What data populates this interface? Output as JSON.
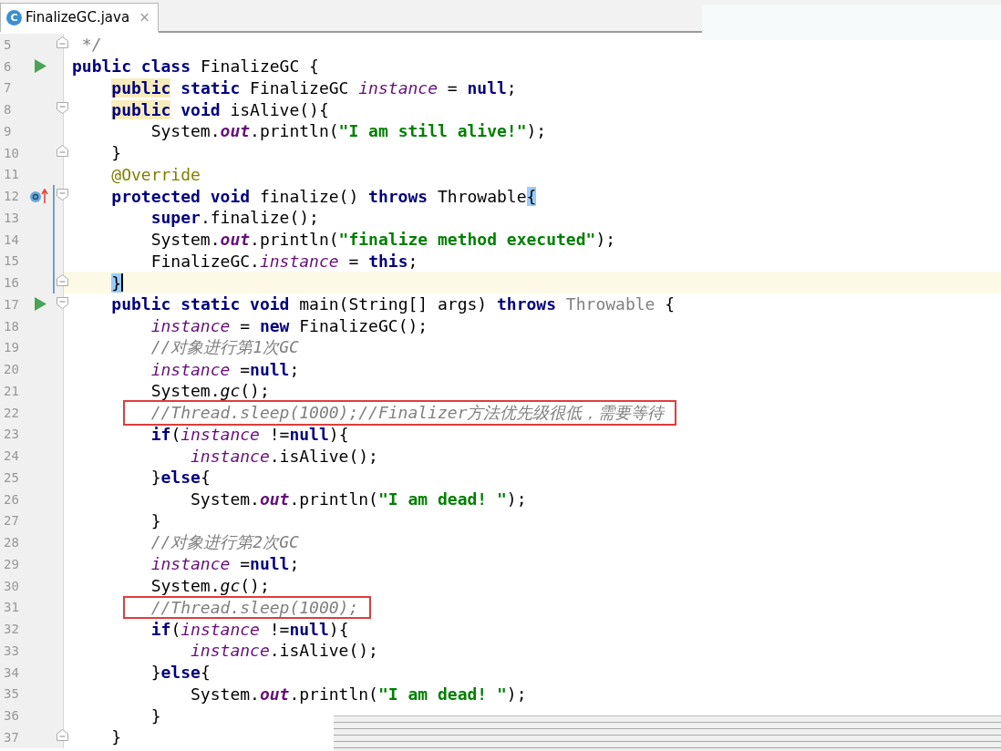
{
  "tab": {
    "label": "FinalizeGC.java",
    "selected": true,
    "icon": "C",
    "close": "×"
  },
  "lines": [
    {
      "number": "5",
      "fold_end": true,
      "tokens": [
        {
          "kind": "comment",
          "text": " */"
        }
      ]
    },
    {
      "number": "6",
      "run_marker": true,
      "tokens": [
        {
          "kind": "keyword",
          "text": "public class"
        },
        {
          "kind": "plain",
          "text": " FinalizeGC {"
        }
      ],
      "children": [
        {
          "number": "7",
          "tokens": [
            {
              "kind": "keyword",
              "text": "public",
              "usage_highlight": true
            },
            {
              "kind": "keyword",
              "text": " static"
            },
            {
              "kind": "plain",
              "text": " FinalizeGC "
            },
            {
              "kind": "field",
              "text": "instance"
            },
            {
              "kind": "plain",
              "text": " = "
            },
            {
              "kind": "keyword",
              "text": "null"
            },
            {
              "kind": "plain",
              "text": ";"
            }
          ]
        },
        {
          "number": "8",
          "fold_start": true,
          "tokens": [
            {
              "kind": "keyword",
              "text": "public",
              "usage_highlight": true
            },
            {
              "kind": "keyword",
              "text": " void"
            },
            {
              "kind": "plain",
              "text": " isAlive(){"
            }
          ],
          "children": [
            {
              "number": "9",
              "tokens": [
                {
                  "kind": "plain",
                  "text": "System."
                },
                {
                  "kind": "static-field",
                  "text": "out"
                },
                {
                  "kind": "plain",
                  "text": ".println("
                },
                {
                  "kind": "string",
                  "text": "\"I am still alive!\""
                },
                {
                  "kind": "plain",
                  "text": ");"
                }
              ]
            }
          ]
        },
        {
          "number": "10",
          "fold_end": true,
          "tokens": [
            {
              "kind": "plain",
              "text": "}"
            }
          ]
        },
        {
          "number": "11",
          "tokens": [
            {
              "kind": "annotation",
              "text": "@Override"
            }
          ]
        },
        {
          "number": "12",
          "override_marker": true,
          "fold_start": true,
          "changed": true,
          "tokens": [
            {
              "kind": "keyword",
              "text": "protected void"
            },
            {
              "kind": "plain",
              "text": " finalize() "
            },
            {
              "kind": "keyword",
              "text": "throws"
            },
            {
              "kind": "plain",
              "text": " Throwable"
            },
            {
              "kind": "plain",
              "text": "{",
              "brace_match": true
            }
          ],
          "children": [
            {
              "number": "13",
              "changed": true,
              "tokens": [
                {
                  "kind": "keyword",
                  "text": "super"
                },
                {
                  "kind": "plain",
                  "text": ".finalize();"
                }
              ]
            },
            {
              "number": "14",
              "changed": true,
              "tokens": [
                {
                  "kind": "plain",
                  "text": "System."
                },
                {
                  "kind": "static-field",
                  "text": "out"
                },
                {
                  "kind": "plain",
                  "text": ".println("
                },
                {
                  "kind": "string",
                  "text": "\"finalize method executed\""
                },
                {
                  "kind": "plain",
                  "text": ");"
                }
              ]
            },
            {
              "number": "15",
              "changed": true,
              "tokens": [
                {
                  "kind": "plain",
                  "text": "FinalizeGC."
                },
                {
                  "kind": "field",
                  "text": "instance"
                },
                {
                  "kind": "plain",
                  "text": " = "
                },
                {
                  "kind": "keyword",
                  "text": "this"
                },
                {
                  "kind": "plain",
                  "text": ";"
                }
              ]
            }
          ]
        },
        {
          "number": "16",
          "fold_end": true,
          "changed": true,
          "current": true,
          "caret": true,
          "tokens": [
            {
              "kind": "plain",
              "text": "}",
              "brace_match": true
            }
          ]
        },
        {
          "number": "17",
          "run_marker": true,
          "fold_start": true,
          "tokens": [
            {
              "kind": "keyword",
              "text": "public static void"
            },
            {
              "kind": "plain",
              "text": " main(String[] args) "
            },
            {
              "kind": "keyword",
              "text": "throws"
            },
            {
              "kind": "muted",
              "text": " Throwable"
            },
            {
              "kind": "plain",
              "text": " {"
            }
          ],
          "children": [
            {
              "number": "18",
              "tokens": [
                {
                  "kind": "field",
                  "text": "instance"
                },
                {
                  "kind": "plain",
                  "text": " = "
                },
                {
                  "kind": "keyword",
                  "text": "new"
                },
                {
                  "kind": "plain",
                  "text": " FinalizeGC();"
                }
              ]
            },
            {
              "number": "19",
              "tokens": [
                {
                  "kind": "comment",
                  "text": "//对象进行第1次GC"
                }
              ]
            },
            {
              "number": "20",
              "tokens": [
                {
                  "kind": "field",
                  "text": "instance"
                },
                {
                  "kind": "plain",
                  "text": " ="
                },
                {
                  "kind": "keyword",
                  "text": "null"
                },
                {
                  "kind": "plain",
                  "text": ";"
                }
              ]
            },
            {
              "number": "21",
              "tokens": [
                {
                  "kind": "plain",
                  "text": "System."
                },
                {
                  "kind": "static-call",
                  "text": "gc"
                },
                {
                  "kind": "plain",
                  "text": "();"
                }
              ]
            },
            {
              "number": "22",
              "tokens": [
                {
                  "kind": "comment",
                  "text": "//Thread.sleep(1000);//Finalizer方法优先级很低，需要等待",
                  "boxed": true
                }
              ]
            },
            {
              "number": "23",
              "tokens": [
                {
                  "kind": "keyword",
                  "text": "if"
                },
                {
                  "kind": "plain",
                  "text": "("
                },
                {
                  "kind": "field",
                  "text": "instance"
                },
                {
                  "kind": "plain",
                  "text": " !="
                },
                {
                  "kind": "keyword",
                  "text": "null"
                },
                {
                  "kind": "plain",
                  "text": "){"
                }
              ],
              "children": [
                {
                  "number": "24",
                  "tokens": [
                    {
                      "kind": "field",
                      "text": "instance"
                    },
                    {
                      "kind": "plain",
                      "text": ".isAlive();"
                    }
                  ]
                }
              ]
            },
            {
              "number": "25",
              "tokens": [
                {
                  "kind": "plain",
                  "text": "}"
                },
                {
                  "kind": "keyword",
                  "text": "else"
                },
                {
                  "kind": "plain",
                  "text": "{"
                }
              ],
              "children": [
                {
                  "number": "26",
                  "tokens": [
                    {
                      "kind": "plain",
                      "text": "System."
                    },
                    {
                      "kind": "static-field",
                      "text": "out"
                    },
                    {
                      "kind": "plain",
                      "text": ".println("
                    },
                    {
                      "kind": "string",
                      "text": "\"I am dead! \""
                    },
                    {
                      "kind": "plain",
                      "text": ");"
                    }
                  ]
                }
              ]
            },
            {
              "number": "27",
              "tokens": [
                {
                  "kind": "plain",
                  "text": "}"
                }
              ]
            },
            {
              "number": "28",
              "tokens": [
                {
                  "kind": "comment",
                  "text": "//对象进行第2次GC"
                }
              ]
            },
            {
              "number": "29",
              "tokens": [
                {
                  "kind": "field",
                  "text": "instance"
                },
                {
                  "kind": "plain",
                  "text": " ="
                },
                {
                  "kind": "keyword",
                  "text": "null"
                },
                {
                  "kind": "plain",
                  "text": ";"
                }
              ]
            },
            {
              "number": "30",
              "tokens": [
                {
                  "kind": "plain",
                  "text": "System."
                },
                {
                  "kind": "static-call",
                  "text": "gc"
                },
                {
                  "kind": "plain",
                  "text": "();"
                }
              ]
            },
            {
              "number": "31",
              "tokens": [
                {
                  "kind": "comment",
                  "text": "//Thread.sleep(1000);",
                  "boxed": true
                }
              ]
            },
            {
              "number": "32",
              "tokens": [
                {
                  "kind": "keyword",
                  "text": "if"
                },
                {
                  "kind": "plain",
                  "text": "("
                },
                {
                  "kind": "field",
                  "text": "instance"
                },
                {
                  "kind": "plain",
                  "text": " !="
                },
                {
                  "kind": "keyword",
                  "text": "null"
                },
                {
                  "kind": "plain",
                  "text": "){"
                }
              ],
              "children": [
                {
                  "number": "33",
                  "tokens": [
                    {
                      "kind": "field",
                      "text": "instance"
                    },
                    {
                      "kind": "plain",
                      "text": ".isAlive();"
                    }
                  ]
                }
              ]
            },
            {
              "number": "34",
              "tokens": [
                {
                  "kind": "plain",
                  "text": "}"
                },
                {
                  "kind": "keyword",
                  "text": "else"
                },
                {
                  "kind": "plain",
                  "text": "{"
                }
              ],
              "children": [
                {
                  "number": "35",
                  "tokens": [
                    {
                      "kind": "plain",
                      "text": "System."
                    },
                    {
                      "kind": "static-field",
                      "text": "out"
                    },
                    {
                      "kind": "plain",
                      "text": ".println("
                    },
                    {
                      "kind": "string",
                      "text": "\"I am dead! \""
                    },
                    {
                      "kind": "plain",
                      "text": ");"
                    }
                  ]
                }
              ]
            },
            {
              "number": "36",
              "tokens": [
                {
                  "kind": "plain",
                  "text": "}"
                }
              ]
            }
          ]
        },
        {
          "number": "37",
          "fold_end": true,
          "tokens": [
            {
              "kind": "plain",
              "text": "}"
            }
          ]
        }
      ]
    }
  ]
}
